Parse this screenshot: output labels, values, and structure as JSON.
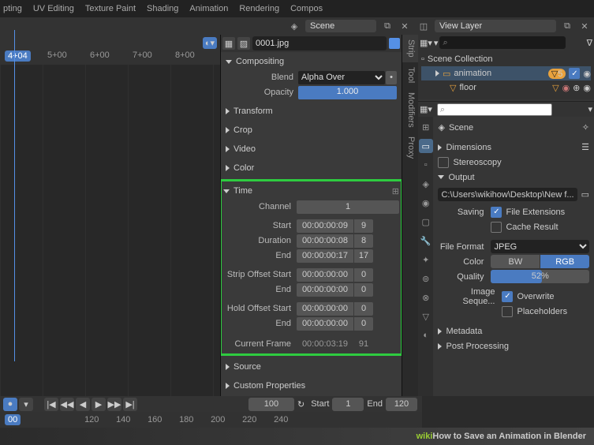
{
  "topbar": [
    "pting",
    "UV Editing",
    "Texture Paint",
    "Shading",
    "Animation",
    "Rendering",
    "Compos"
  ],
  "scene_name": "Scene",
  "viewlayer_name": "View Layer",
  "strip_name": "0001.jpg",
  "vtabs": [
    "Strip",
    "Tool",
    "Modifiers",
    "Proxy"
  ],
  "compositing": {
    "title": "Compositing",
    "blend_lbl": "Blend",
    "blend_val": "Alpha Over",
    "opacity_lbl": "Opacity",
    "opacity_val": "1.000"
  },
  "panels": {
    "transform": "Transform",
    "crop": "Crop",
    "video": "Video",
    "color": "Color"
  },
  "time": {
    "title": "Time",
    "channel_lbl": "Channel",
    "channel": "1",
    "start_lbl": "Start",
    "start_tc": "00:00:00:09",
    "start_fr": "9",
    "duration_lbl": "Duration",
    "duration_tc": "00:00:00:08",
    "duration_fr": "8",
    "end_lbl": "End",
    "end_tc": "00:00:00:17",
    "end_fr": "17",
    "so_start_lbl": "Strip Offset Start",
    "so_start_tc": "00:00:00:00",
    "so_start_fr": "0",
    "so_end_lbl": "End",
    "so_end_tc": "00:00:00:00",
    "so_end_fr": "0",
    "ho_start_lbl": "Hold Offset Start",
    "ho_start_tc": "00:00:00:00",
    "ho_start_fr": "0",
    "ho_end_lbl": "End",
    "ho_end_tc": "00:00:00:00",
    "ho_end_fr": "0",
    "cf_lbl": "Current Frame",
    "cf_tc": "00:00:03:19",
    "cf_fr": "91"
  },
  "source": "Source",
  "custom_props": "Custom Properties",
  "timeline": {
    "cur": "4+04",
    "marks": [
      "5+00",
      "6+00",
      "7+00",
      "8+00"
    ]
  },
  "playbar": {
    "cur": "100",
    "start_lbl": "Start",
    "start": "1",
    "end_lbl": "End",
    "end": "120"
  },
  "frames": {
    "cur": "00",
    "marks": [
      "120",
      "140",
      "160",
      "180",
      "200",
      "220",
      "240"
    ]
  },
  "outliner": {
    "collection": "Scene Collection",
    "anim": "animation",
    "anim_badge": "5",
    "floor": "floor"
  },
  "right": {
    "scene": "Scene",
    "dimensions": "Dimensions",
    "stereoscopy": "Stereoscopy",
    "output": "Output",
    "path": "C:\\Users\\wikihow\\Desktop\\New f...",
    "saving_lbl": "Saving",
    "file_ext": "File Extensions",
    "cache": "Cache Result",
    "format_lbl": "File Format",
    "format": "JPEG",
    "color_lbl": "Color",
    "bw": "BW",
    "rgb": "RGB",
    "quality_lbl": "Quality",
    "quality": "52%",
    "seq_lbl": "Image Seque...",
    "overwrite": "Overwrite",
    "placeholders": "Placeholders",
    "metadata": "Metadata",
    "post": "Post Processing"
  },
  "caption": {
    "wiki": "wiki",
    "how": "How",
    "rest": " to Save an Animation in Blender"
  }
}
